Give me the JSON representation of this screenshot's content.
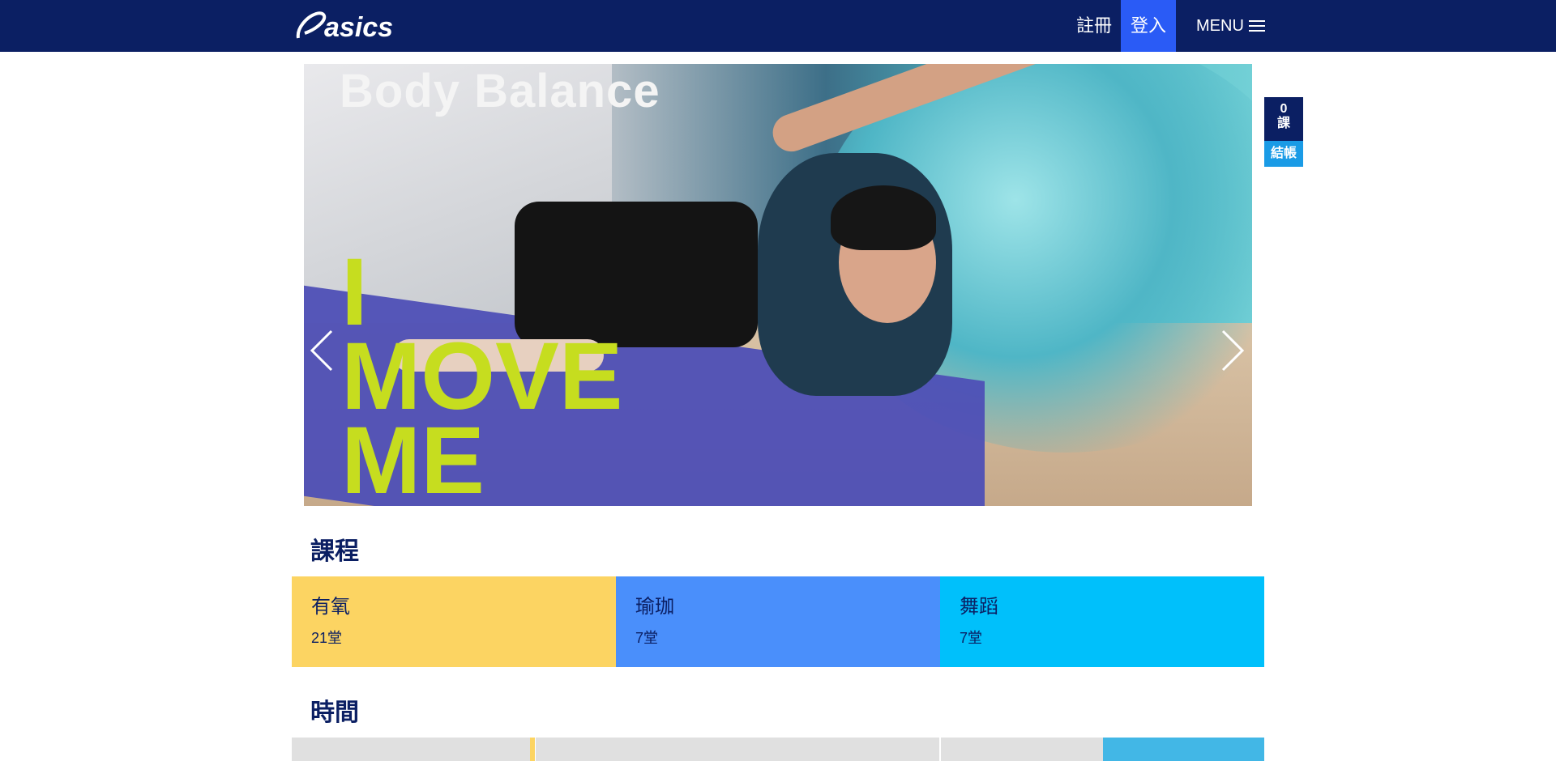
{
  "header": {
    "logo_text": "asics",
    "register_label": "註冊",
    "login_label": "登入",
    "menu_label": "MENU",
    "background_color": "#0b1f63",
    "login_color": "#2a5bf6"
  },
  "hero": {
    "title": "Body Balance",
    "slogan_line1": "I",
    "slogan_line2": "MOVE",
    "slogan_line3": "ME",
    "prev_icon": "chevron-left-icon",
    "next_icon": "chevron-right-icon"
  },
  "cart": {
    "count": "0",
    "unit": "課",
    "checkout_label": "結帳"
  },
  "sections": {
    "courses_title": "課程",
    "time_title": "時間"
  },
  "categories": [
    {
      "name": "有氧",
      "count": "21堂",
      "color": "#fcd462"
    },
    {
      "name": "瑜珈",
      "count": "7堂",
      "color": "#4a8ffb"
    },
    {
      "name": "舞蹈",
      "count": "7堂",
      "color": "#00c0fb"
    }
  ],
  "colors": {
    "text_primary": "#0b1f63",
    "cart_checkout": "#1a9be6",
    "hero_slogan": "#c6dd1f"
  }
}
